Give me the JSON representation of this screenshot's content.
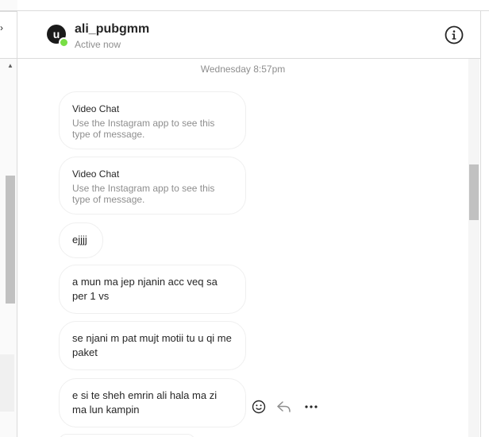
{
  "header": {
    "username": "ali_pubgmm",
    "status": "Active now",
    "avatar_letter": "u"
  },
  "thread": {
    "timestamp": "Wednesday 8:57pm",
    "messages": [
      {
        "type": "card",
        "title": "Video Chat",
        "subtitle": "Use the Instagram app to see this type of message."
      },
      {
        "type": "card",
        "title": "Video Chat",
        "subtitle": "Use the Instagram app to see this type of message."
      },
      {
        "type": "text",
        "text": "ejjjj"
      },
      {
        "type": "text",
        "text": "a mun ma jep njanin acc veq sa per 1 vs"
      },
      {
        "type": "text",
        "text": "se njani m pat mujt motii tu u qi me paket"
      },
      {
        "type": "text",
        "text": "e si te sheh emrin ali hala ma zi ma lun kampin"
      }
    ]
  },
  "icons": {
    "info": "info-icon",
    "emoji": "emoji-icon",
    "reply": "reply-icon",
    "more": "more-icon"
  },
  "colors": {
    "online": "#78de45",
    "border": "#dbdbdb",
    "muted": "#8e8e8e",
    "text": "#262626"
  }
}
